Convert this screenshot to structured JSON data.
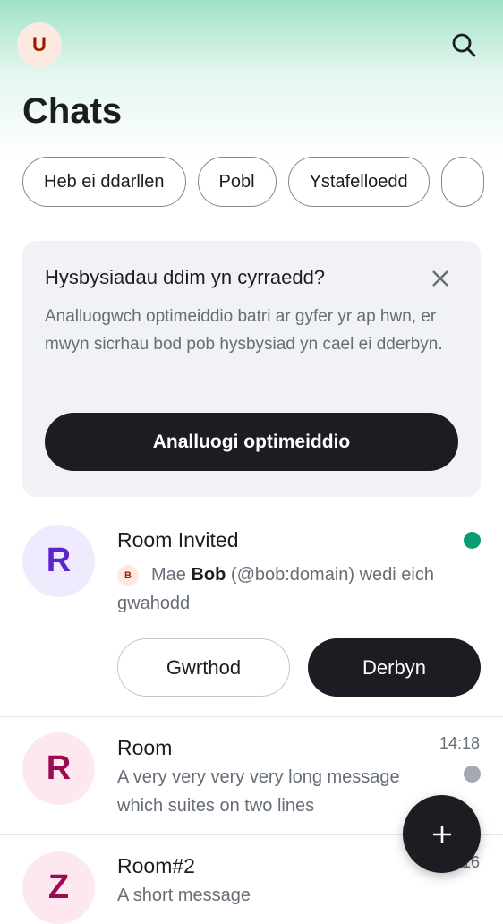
{
  "header": {
    "user_initial": "U",
    "title": "Chats"
  },
  "filters": [
    "Heb ei ddarllen",
    "Pobl",
    "Ystafelloedd",
    ""
  ],
  "banner": {
    "title": "Hysbysiadau ddim yn cyrraedd?",
    "text": "Analluogwch optimeiddio batri ar gyfer yr ap hwn, er mwyn sicrhau bod pob hysbysiad yn cael ei dderbyn.",
    "button": "Analluogi optimeiddio"
  },
  "invite": {
    "initial": "R",
    "name": "Room Invited",
    "inviter_initial": "B",
    "msg_prefix": "Mae ",
    "inviter": "Bob",
    "msg_suffix": " (@bob:domain) wedi eich gwahodd",
    "decline": "Gwrthod",
    "accept": "Derbyn",
    "dot_color": "#0b9c74"
  },
  "rooms": [
    {
      "initial": "R",
      "name": "Room",
      "time": "14:18",
      "message": "A very very very very long message which suites on two lines"
    },
    {
      "initial": "Z",
      "name": "Room#2",
      "time": "14:16",
      "message": "A short message"
    }
  ]
}
